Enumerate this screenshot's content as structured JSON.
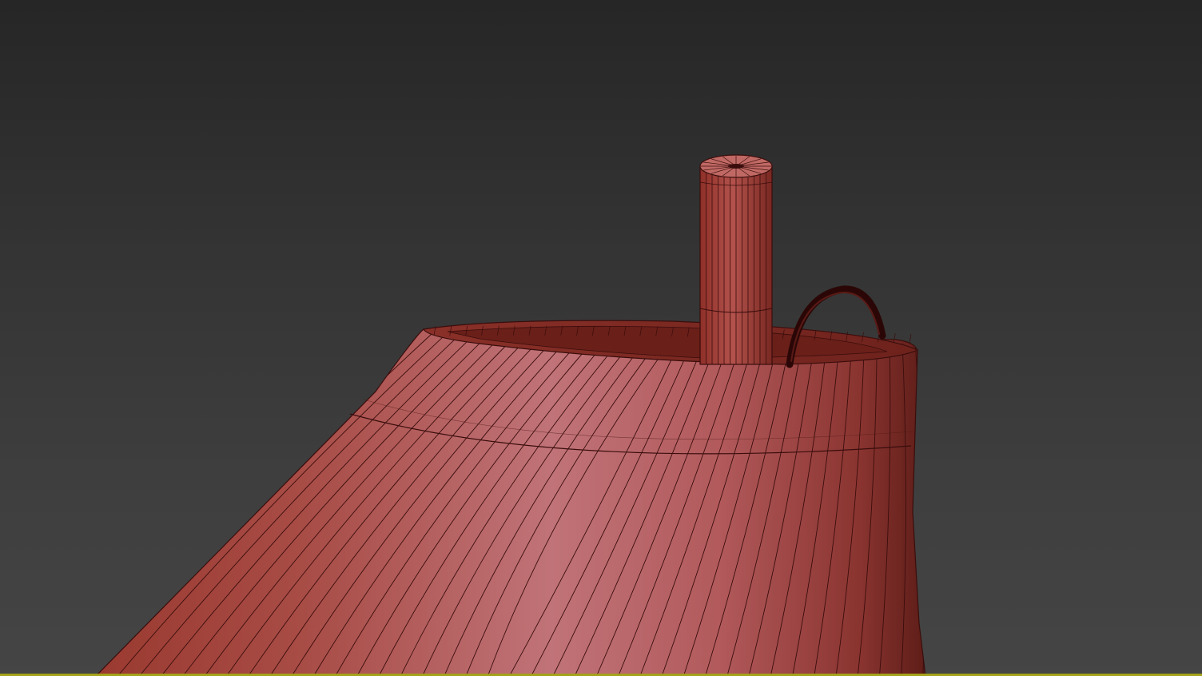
{
  "viewport": {
    "background_top": "#262626",
    "background_bottom": "#454545",
    "active_border_color": "#a4a11a"
  },
  "model": {
    "base_color": "#b55450",
    "highlight_color": "#c47a80",
    "shadow_color": "#8e2f26",
    "wire_color": "#3a0d0c",
    "cable_color": "#2a0706"
  }
}
